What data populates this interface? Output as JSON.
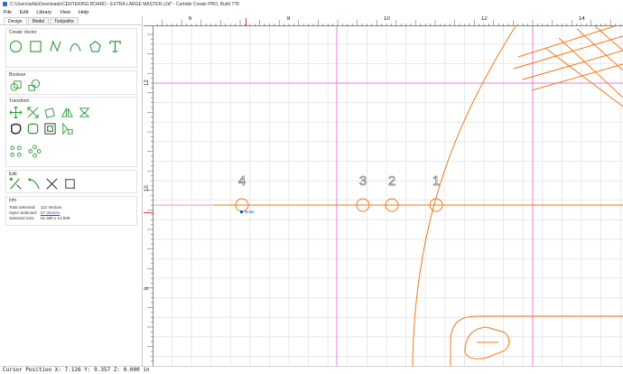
{
  "window": {
    "title": "C:\\Users\\willa\\Downloads\\CENTERING BOARD - EXTRA LARGE MASTER.c2d* - Carbide Create PRO, Build 778"
  },
  "menu": [
    "File",
    "Edit",
    "Library",
    "View",
    "Help"
  ],
  "tabs": [
    "Design",
    "Model",
    "Toolpaths"
  ],
  "sidebar": {
    "create_vector_title": "Create Vector",
    "boolean_title": "Boolean",
    "transform_title": "Transform",
    "edit_title": "Edit",
    "info_title": "Info",
    "info": {
      "total_selected_label": "Total Selected:",
      "total_selected_value": "112 Vectors",
      "open_selected_label": "Open Selected:",
      "open_selected_value": "57 Vectors",
      "selected_size_label": "Selected Size:",
      "selected_size_value": "51.490 x 14.839"
    }
  },
  "canvas": {
    "ruler_top_labels": [
      "6",
      "8",
      "10",
      "12",
      "14"
    ],
    "ruler_left_labels": [
      "12",
      "10",
      "8"
    ],
    "markers": [
      "4",
      "3",
      "2",
      "1"
    ],
    "node_label": "Node"
  },
  "colors": {
    "vector": "#f07a1a",
    "guide": "#e77ee0",
    "selected_guide": "#ff9a9a",
    "grid_minor": "#e6e6e6",
    "grid_major": "#cfcfcf",
    "icon_green": "#2f9b3a",
    "ruler_marker": "#e23a3a"
  },
  "status": {
    "cursor_text": "Cursor Position X: 7.126 Y: 9.357 Z: 0.000 in"
  }
}
